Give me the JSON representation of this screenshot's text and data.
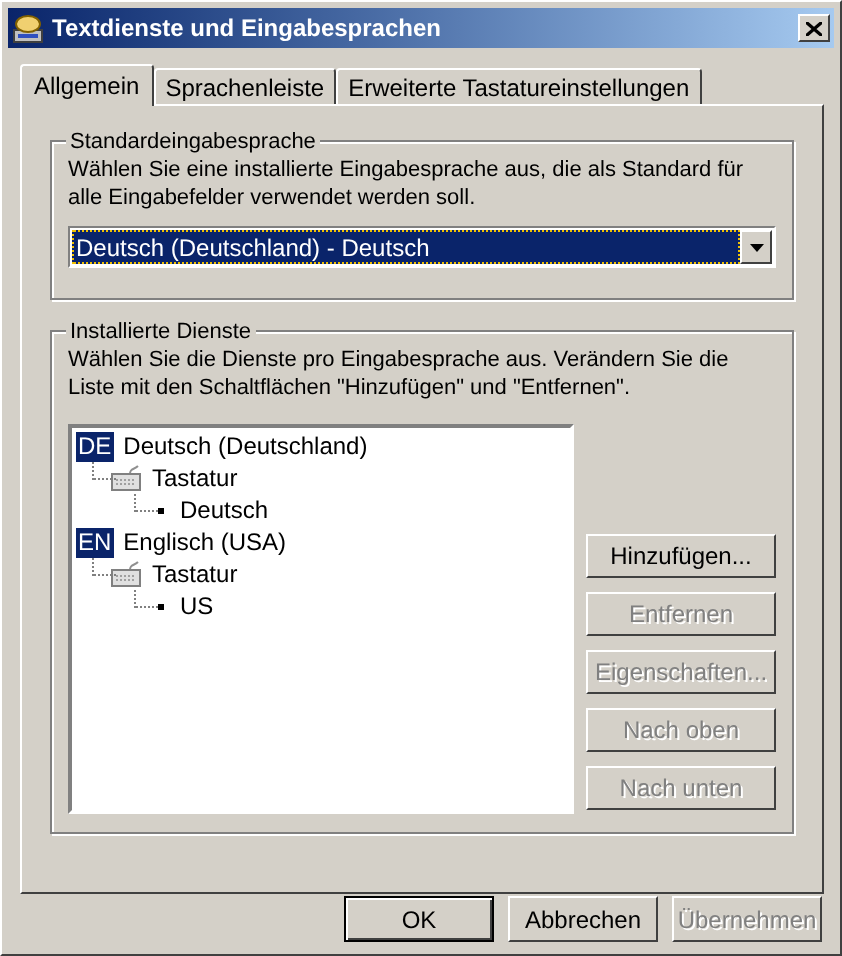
{
  "window": {
    "title": "Textdienste und Eingabesprachen"
  },
  "tabs": [
    {
      "label": "Allgemein",
      "selected": true
    },
    {
      "label": "Sprachenleiste",
      "selected": false
    },
    {
      "label": "Erweiterte Tastatureinstellungen",
      "selected": false
    }
  ],
  "default_language": {
    "title": "Standardeingabesprache",
    "description": "Wählen Sie eine installierte Eingabesprache aus, die als Standard für alle Eingabefelder verwendet werden soll.",
    "value": "Deutsch (Deutschland) - Deutsch"
  },
  "installed_services": {
    "title": "Installierte Dienste",
    "description": "Wählen Sie die Dienste pro Eingabesprache aus. Verändern Sie die Liste mit den Schaltflächen \"Hinzufügen\" und \"Entfernen\".",
    "tree": [
      {
        "kind": "language",
        "badge": "DE",
        "label": "Deutsch (Deutschland)",
        "children": [
          {
            "kind": "category",
            "label": "Tastatur",
            "children": [
              {
                "kind": "service",
                "label": "Deutsch"
              }
            ]
          }
        ]
      },
      {
        "kind": "language",
        "badge": "EN",
        "label": "Englisch (USA)",
        "children": [
          {
            "kind": "category",
            "label": "Tastatur",
            "children": [
              {
                "kind": "service",
                "label": "US"
              }
            ]
          }
        ]
      }
    ],
    "buttons": [
      {
        "label": "Hinzufügen...",
        "disabled": false
      },
      {
        "label": "Entfernen",
        "disabled": true
      },
      {
        "label": "Eigenschaften...",
        "disabled": true
      },
      {
        "label": "Nach oben",
        "disabled": true
      },
      {
        "label": "Nach unten",
        "disabled": true
      }
    ]
  },
  "dialog_buttons": [
    {
      "label": "OK",
      "disabled": false,
      "default": true
    },
    {
      "label": "Abbrechen",
      "disabled": false,
      "default": false
    },
    {
      "label": "Übernehmen",
      "disabled": true,
      "default": false
    }
  ]
}
